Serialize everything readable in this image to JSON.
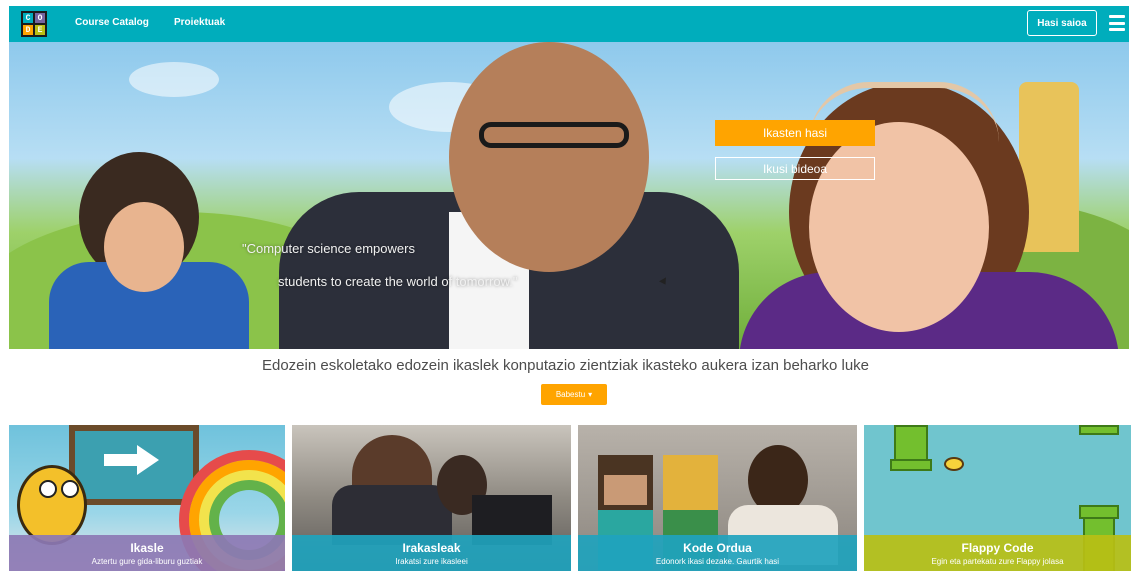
{
  "nav": {
    "logo_letters": [
      "C",
      "O",
      "D",
      "E"
    ],
    "links": [
      "Course Catalog",
      "Proiektuak"
    ],
    "signin_label": "Hasi saioa",
    "menu_icon": "hamburger-icon",
    "color": "#00adbc"
  },
  "hero": {
    "primary_button": "Ikasten hasi",
    "secondary_button": "Ikusi bideoa",
    "quote_line1": "\"Computer science empowers",
    "quote_line2": "students to create the world of tomorrow.\"",
    "accent_color": "#ffa400"
  },
  "tagline": "Edozein eskoletako edozein ikaslek konputazio zientziak ikasteko aukera izan beharko luke",
  "donate_button": "Babestu",
  "tiles": [
    {
      "title": "Ikasle",
      "subtitle": "Aztertu gure gida-liburu guztiak",
      "band_color": "#8c78b4"
    },
    {
      "title": "Irakasleak",
      "subtitle": "Irakatsi zure ikasleei",
      "band_color": "#1fa3bd"
    },
    {
      "title": "Kode Ordua",
      "subtitle": "Edonork ikasi dezake. Gaurtik hasi",
      "band_color": "#1fa3bd"
    },
    {
      "title": "Flappy Code",
      "subtitle": "Egin eta partekatu zure Flappy jolasa",
      "band_color": "#b9bf15"
    }
  ]
}
